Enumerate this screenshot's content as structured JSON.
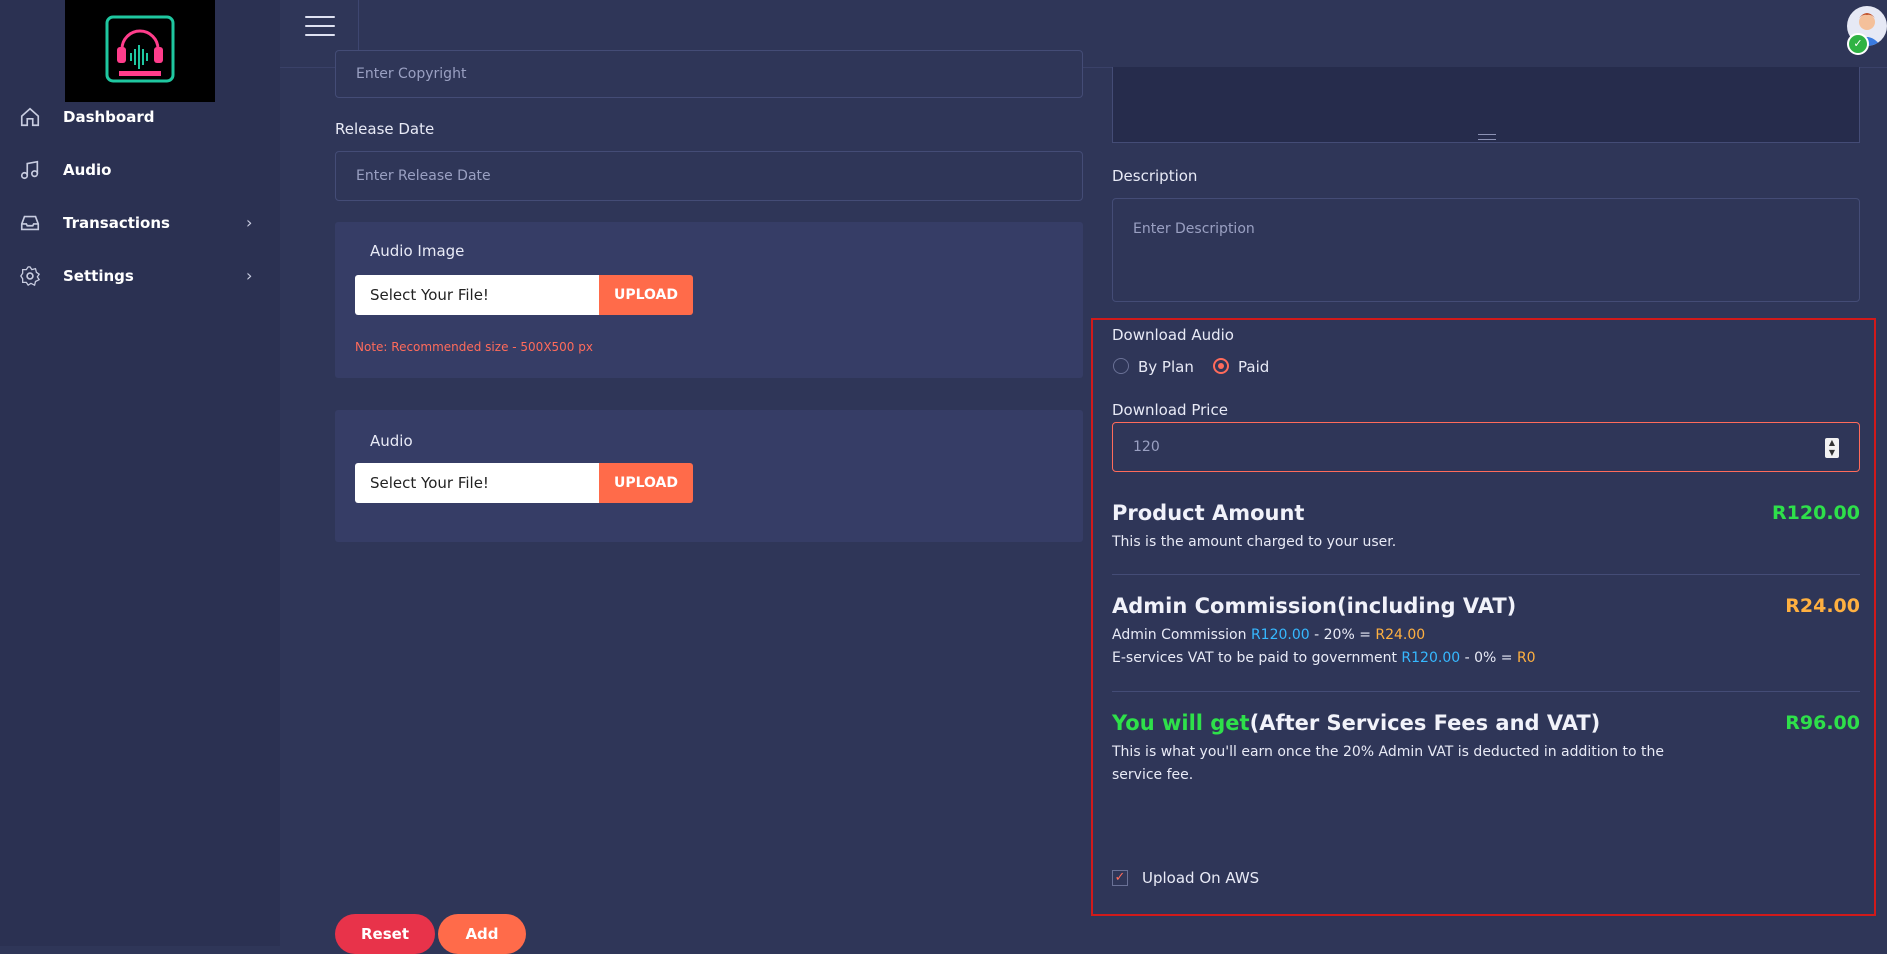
{
  "sidebar": {
    "items": [
      {
        "label": "Dashboard",
        "icon": "home-icon",
        "has_chevron": false
      },
      {
        "label": "Audio",
        "icon": "music-note-icon",
        "has_chevron": false
      },
      {
        "label": "Transactions",
        "icon": "inbox-icon",
        "has_chevron": true
      },
      {
        "label": "Settings",
        "icon": "gear-icon",
        "has_chevron": true
      }
    ]
  },
  "form": {
    "copyright_placeholder": "Enter Copyright",
    "release_date_label": "Release Date",
    "release_date_placeholder": "Enter Release Date",
    "audio_image_label": "Audio Image",
    "audio_image_file": "Select Your File!",
    "audio_image_upload": "UPLOAD",
    "audio_image_note": "Note: Recommended size - 500X500 px",
    "audio_label": "Audio",
    "audio_file": "Select Your File!",
    "audio_upload": "UPLOAD",
    "description_label": "Description",
    "description_placeholder": "Enter Description",
    "download_audio_label": "Download Audio",
    "download_options": [
      "By Plan",
      "Paid"
    ],
    "download_selected": "Paid",
    "download_price_label": "Download Price",
    "download_price_value": "120",
    "upload_aws_label": "Upload On AWS",
    "upload_aws_checked": true,
    "reset_label": "Reset",
    "add_label": "Add"
  },
  "pricing": {
    "product_title": "Product Amount",
    "product_amount": "R120.00",
    "product_desc": "This is the amount charged to your user.",
    "commission_title": "Admin Commission(including VAT)",
    "commission_amount": "R24.00",
    "commission_line_prefix": "Admin Commission ",
    "commission_line_base": "R120.00",
    "commission_line_mid": " - 20% = ",
    "commission_line_result": "R24.00",
    "vat_line_prefix": "E-services VAT to be paid to government ",
    "vat_line_base": "R120.00",
    "vat_line_mid": " - 0% = ",
    "vat_line_result": "R0",
    "earn_title_highlight": "You will get",
    "earn_title_rest": "(After Services Fees and VAT)",
    "earn_amount": "R96.00",
    "earn_desc_1": "This is what you'll earn once the 20% Admin VAT is deducted in addition to the",
    "earn_desc_2": "service fee."
  },
  "colors": {
    "accent": "#ff6b4a",
    "green": "#2ee04a",
    "orange": "#ffb040",
    "blue": "#36b8ff",
    "reset": "#e8334a"
  }
}
